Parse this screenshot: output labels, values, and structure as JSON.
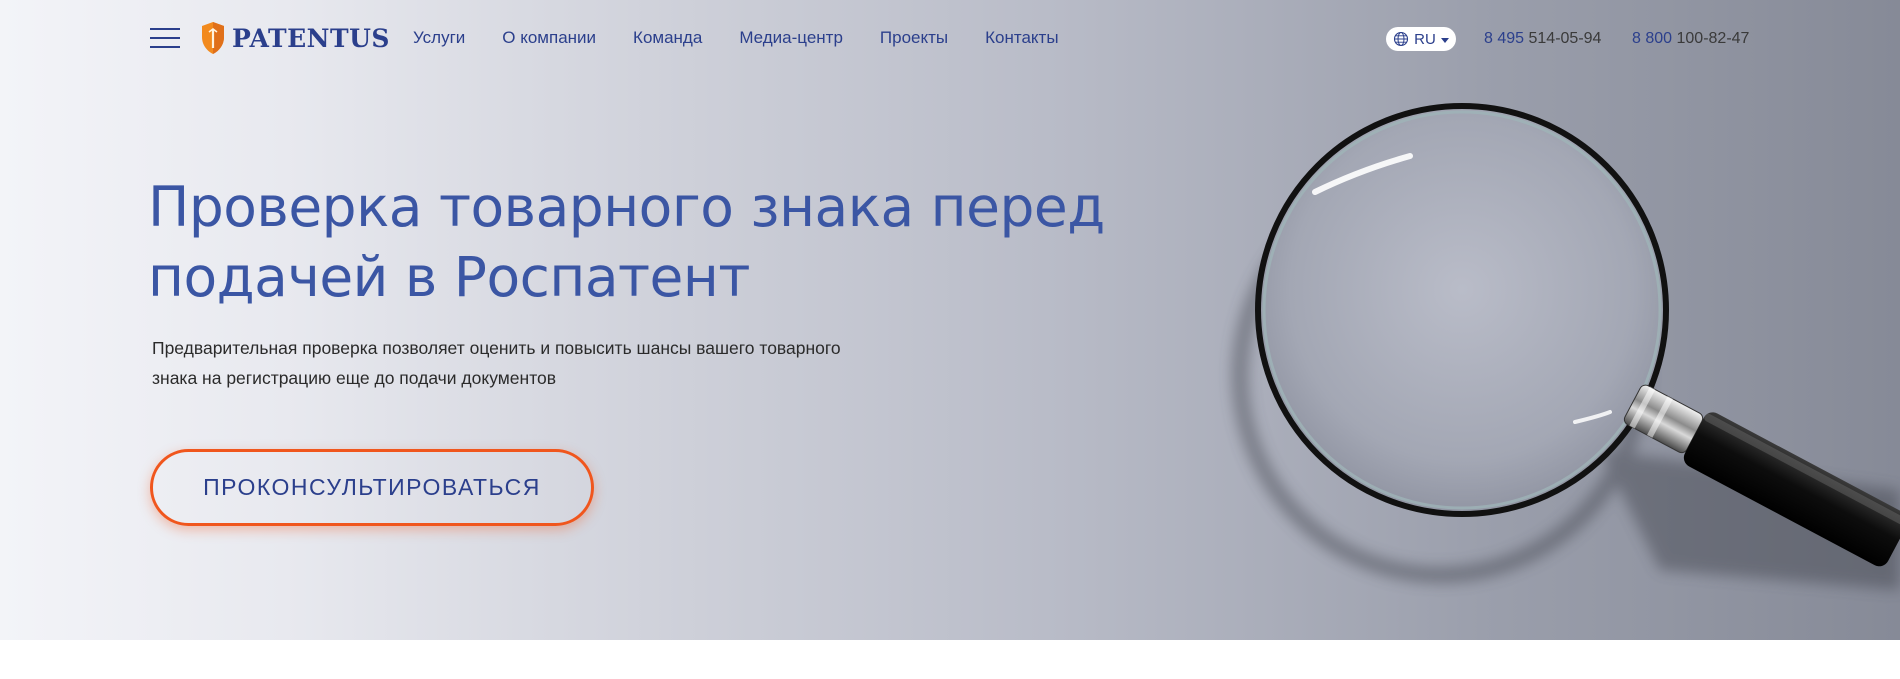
{
  "header": {
    "logo_text": "PATENTUS",
    "nav": [
      {
        "label": "Услуги"
      },
      {
        "label": "О компании"
      },
      {
        "label": "Команда"
      },
      {
        "label": "Медиа-центр"
      },
      {
        "label": "Проекты"
      },
      {
        "label": "Контакты"
      }
    ],
    "language": "RU",
    "phones": [
      {
        "code": "8 495",
        "number": "514-05-94"
      },
      {
        "code": "8 800",
        "number": "100-82-47"
      }
    ]
  },
  "hero": {
    "title_line1": "Проверка товарного знака перед",
    "title_line2": "подачей в Роспатент",
    "subtitle_line1": "Предварительная проверка позволяет оценить и повысить шансы вашего товарного",
    "subtitle_line2": "знака на регистрацию еще до подачи документов",
    "cta_label": "ПРОКОНСУЛЬТИРОВАТЬСЯ",
    "image": "magnifying-glass-illustration"
  },
  "colors": {
    "brand_blue": "#2b3f8c",
    "title_blue": "#3b56a4",
    "accent_orange": "#f0561d",
    "logo_orange": "#f28a1e"
  }
}
